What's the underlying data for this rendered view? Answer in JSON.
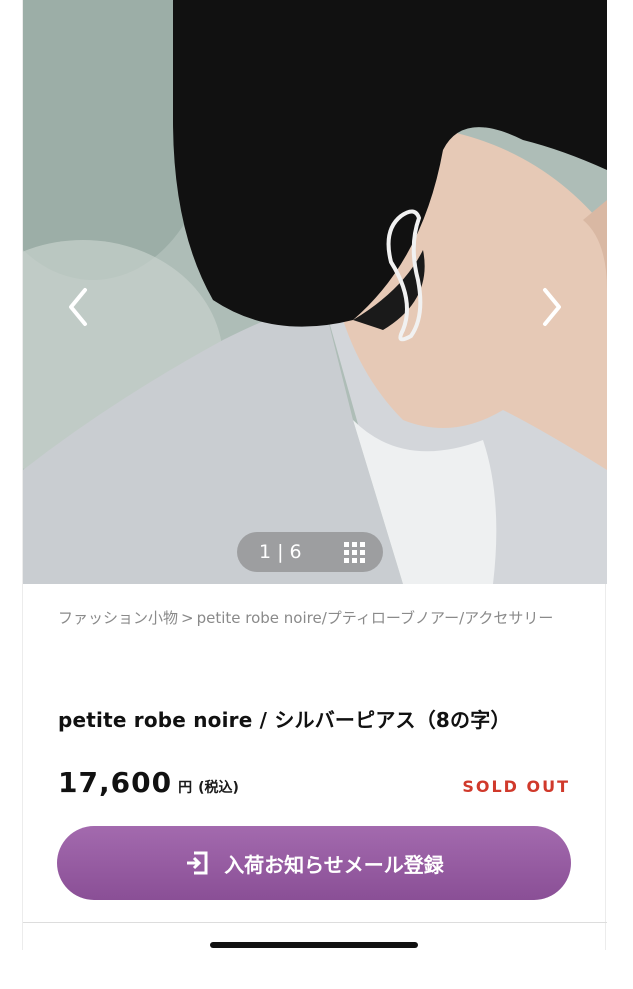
{
  "gallery": {
    "current": "1",
    "separator": "|",
    "total": "6",
    "prev_icon": "chevron-left-icon",
    "next_icon": "chevron-right-icon",
    "grid_icon": "grid-icon"
  },
  "breadcrumb": {
    "category": "ファッション小物",
    "arrow": ">",
    "path": "petite robe noire/プティローブノアー/アクセサリー"
  },
  "product": {
    "title": "petite robe noire / シルバーピアス（8の字）",
    "price": "17,600",
    "currency": "円",
    "tax_note": "(税込)",
    "status": "SOLD OUT"
  },
  "notify_button": {
    "label": "入荷お知らせメール登録",
    "icon": "sign-in-icon"
  },
  "colors": {
    "accent": "#9a5ea4",
    "sold_out": "#d0392b"
  }
}
